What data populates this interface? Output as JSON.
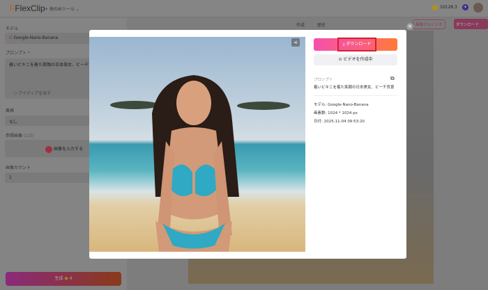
{
  "header": {
    "logo": "FlexClip",
    "ai_tools": "他のAIツール",
    "credits": "10128.3"
  },
  "left": {
    "model_label": "モデル",
    "model_value": "Google-Nano-Banana",
    "prompt_label": "プロンプト",
    "prompt_value": "着いビキニを着た笑顔の日本美女、ビーチ背",
    "idea": "アイディアを出す",
    "style_label": "風格",
    "style_value": "なし",
    "ref_label": "参照画像",
    "ref_hint": "(1/3)",
    "upload": "画像を入力する",
    "count_label": "画像カウント",
    "count_value": "1",
    "generate": "生成",
    "generate_cost": "4"
  },
  "tabs": {
    "create": "作成",
    "history": "歴史"
  },
  "bg_actions": {
    "to_video": "画像からビデオ",
    "download": "ダウンロード"
  },
  "modal": {
    "download": "ダウンロード",
    "make_video": "ビデオを作成中",
    "prompt_label": "プロンプト",
    "prompt": "着いビキニを着た笑顔の日本美女、ビーチ背景",
    "model": "モデル: Google-Nano-Banana",
    "resolution": "画素数: 1024 * 1024 px",
    "date": "日付: 2025-11-04 09:53:20"
  }
}
